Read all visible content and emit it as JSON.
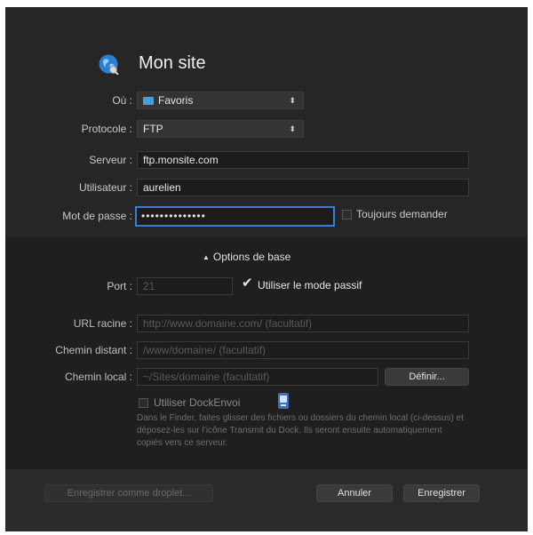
{
  "header": {
    "title": "Mon site",
    "icon": "globe-icon"
  },
  "fields": {
    "where": {
      "label": "Où :",
      "value": "Favoris"
    },
    "protocol": {
      "label": "Protocole :",
      "value": "FTP"
    },
    "server": {
      "label": "Serveur :",
      "value": "ftp.monsite.com"
    },
    "user": {
      "label": "Utilisateur :",
      "value": "aurelien"
    },
    "password": {
      "label": "Mot de passe :",
      "value": "••••••••••••••"
    },
    "always_ask": {
      "label": "Toujours demander"
    }
  },
  "options": {
    "toggle_label": "Options de base",
    "port": {
      "label": "Port :",
      "placeholder": "21"
    },
    "passive": {
      "label": "Utiliser le mode passif",
      "checked": true
    },
    "root_url": {
      "label": "URL racine :",
      "placeholder": "http://www.domaine.com/ (facultatif)"
    },
    "remote_path": {
      "label": "Chemin distant :",
      "placeholder": "/www/domaine/ (facultatif)"
    },
    "local_path": {
      "label": "Chemin local :",
      "placeholder": "~/Sites/domaine (facultatif)"
    },
    "define_button": "Définir...",
    "dock_send": {
      "label": "Utiliser DockEnvoi"
    },
    "help_text": "Dans le Finder, faites glisser des fichiers ou dossiers du chemin local (ci-dessus) et déposez-les sur l’icône Transmit du Dock. Ils seront ensuite automatiquement copiés vers ce serveur."
  },
  "footer": {
    "droplet_button": "Enregistrer comme droplet...",
    "cancel_button": "Annuler",
    "save_button": "Enregistrer"
  },
  "colors": {
    "background": "#262626",
    "focus_ring": "#3d7cd6",
    "folder": "#3fa0e8"
  }
}
